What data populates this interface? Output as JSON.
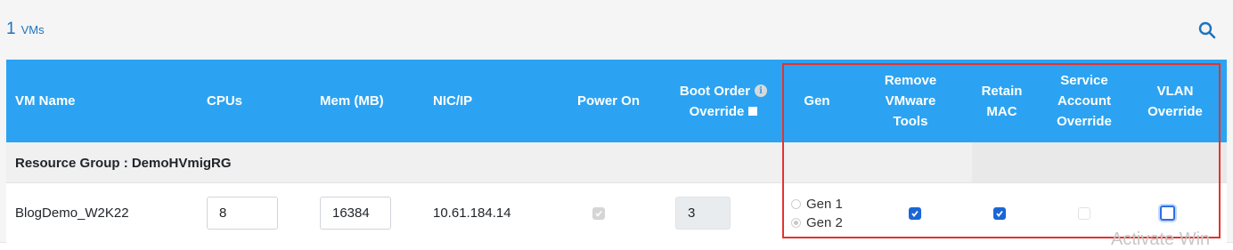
{
  "summary": {
    "vm_count": "1",
    "vm_label": "VMs"
  },
  "toolbar": {
    "search_icon": "search-icon"
  },
  "table": {
    "headers": {
      "vm_name": "VM Name",
      "cpus": "CPUs",
      "mem": "Mem (MB)",
      "nic_ip": "NIC/IP",
      "power_on": "Power On",
      "boot_order_line1": "Boot Order",
      "boot_order_line2": "Override",
      "gen": "Gen",
      "remove_vmware_tools": [
        "Remove",
        "VMware",
        "Tools"
      ],
      "retain_mac": [
        "Retain",
        "MAC"
      ],
      "service_account_override": [
        "Service",
        "Account",
        "Override"
      ],
      "vlan_override": [
        "VLAN",
        "Override"
      ]
    },
    "group": {
      "label": "Resource Group : DemoHVmigRG"
    },
    "rows": [
      {
        "vm_name": "BlogDemo_W2K22",
        "cpus": "8",
        "mem": "16384",
        "nic_ip": "10.61.184.14",
        "power_on": true,
        "boot_order": "3",
        "gen_options": [
          "Gen 1",
          "Gen 2"
        ],
        "gen_selected": "Gen 2",
        "remove_vmware_tools": true,
        "retain_mac": true,
        "service_account_override": false,
        "vlan_override": false
      }
    ]
  },
  "colors": {
    "accent": "#1e73be",
    "header_bg": "#2ba3f2",
    "checkbox_checked": "#1a66d6",
    "highlight_border": "#e5322d"
  },
  "watermark": {
    "text": "Activate Win"
  }
}
